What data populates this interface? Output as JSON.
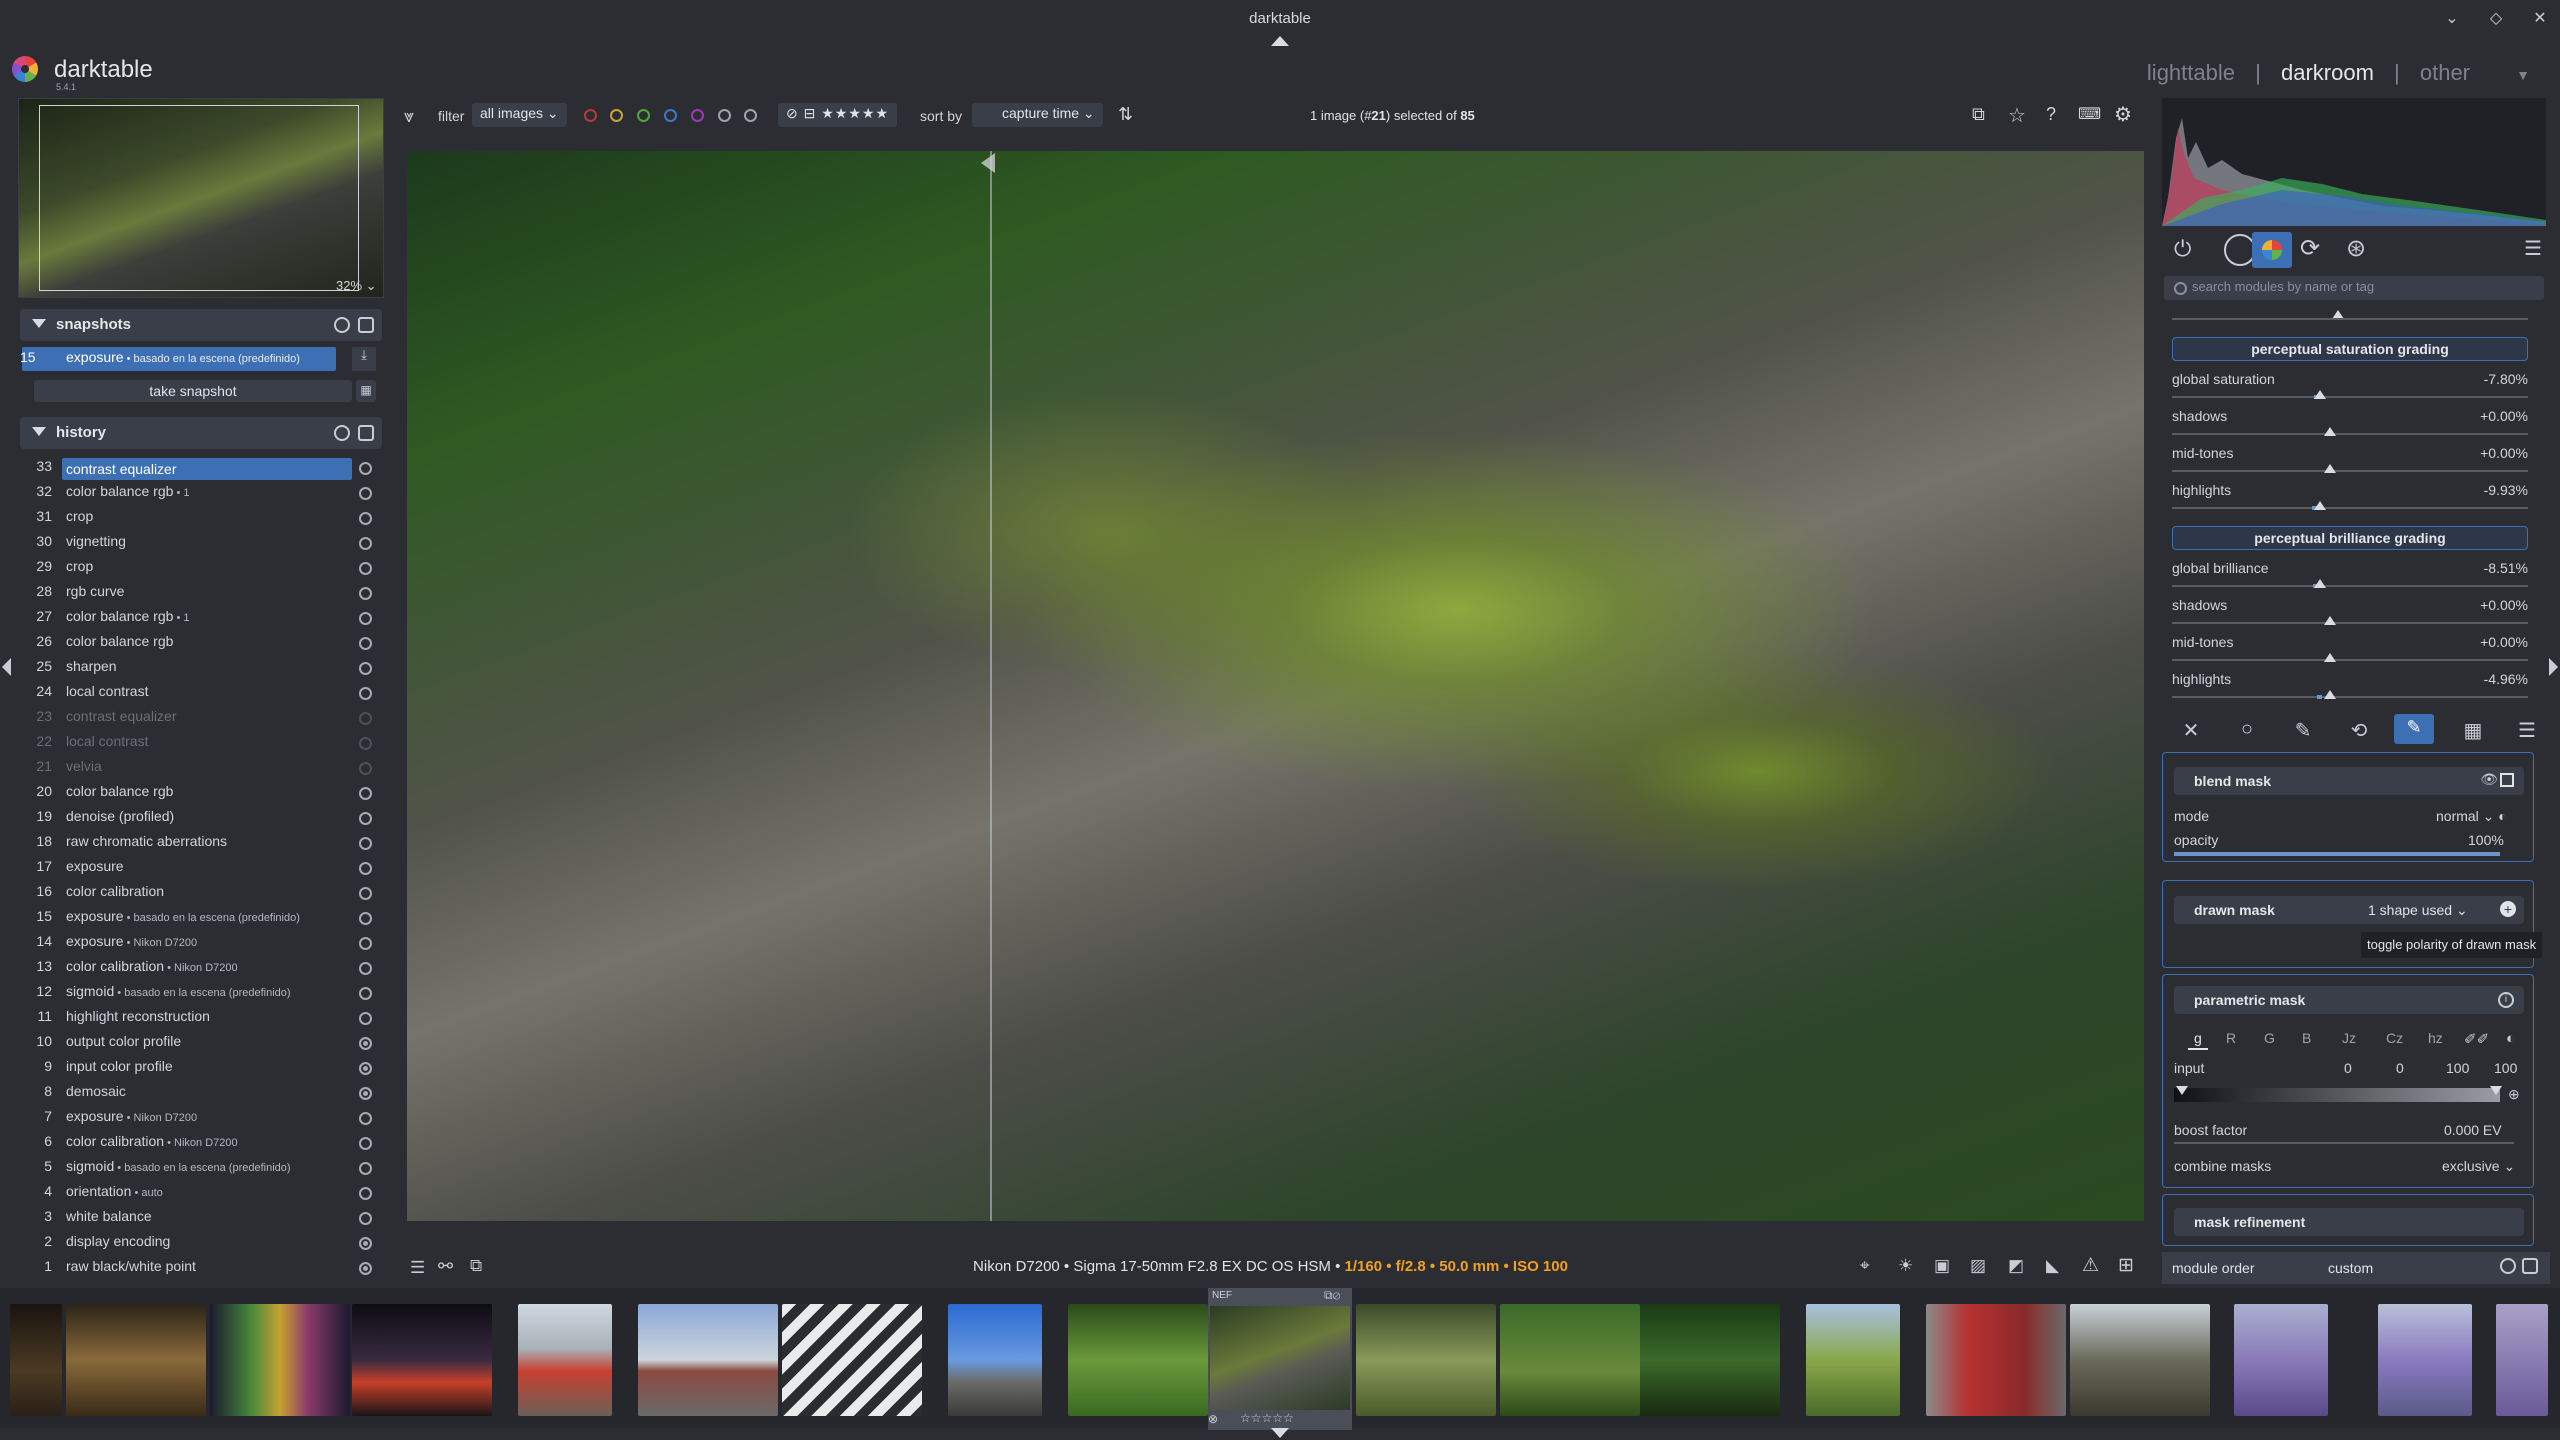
{
  "window": {
    "title": "darktable"
  },
  "app": {
    "name": "darktable",
    "version": "5.4.1"
  },
  "views": {
    "lighttable": "lighttable",
    "darkroom": "darkroom",
    "other": "other",
    "sep": "|"
  },
  "navigation": {
    "zoom": "32%"
  },
  "snapshots": {
    "title": "snapshots",
    "item": {
      "num": "15",
      "label": "exposure",
      "note": " • basado en la escena (predefinido)"
    },
    "take_label": "take snapshot"
  },
  "history": {
    "title": "history",
    "items": [
      {
        "num": "33",
        "label": "contrast equalizer",
        "note": ""
      },
      {
        "num": "32",
        "label": "color balance rgb",
        "note": " • 1"
      },
      {
        "num": "31",
        "label": "crop",
        "note": ""
      },
      {
        "num": "30",
        "label": "vignetting",
        "note": ""
      },
      {
        "num": "29",
        "label": "crop",
        "note": ""
      },
      {
        "num": "28",
        "label": "rgb curve",
        "note": ""
      },
      {
        "num": "27",
        "label": "color balance rgb",
        "note": " • 1"
      },
      {
        "num": "26",
        "label": "color balance rgb",
        "note": ""
      },
      {
        "num": "25",
        "label": "sharpen",
        "note": ""
      },
      {
        "num": "24",
        "label": "local contrast",
        "note": ""
      },
      {
        "num": "23",
        "label": "contrast equalizer",
        "note": ""
      },
      {
        "num": "22",
        "label": "local contrast",
        "note": ""
      },
      {
        "num": "21",
        "label": "velvia",
        "note": ""
      },
      {
        "num": "20",
        "label": "color balance rgb",
        "note": ""
      },
      {
        "num": "19",
        "label": "denoise (profiled)",
        "note": ""
      },
      {
        "num": "18",
        "label": "raw chromatic aberrations",
        "note": ""
      },
      {
        "num": "17",
        "label": "exposure",
        "note": ""
      },
      {
        "num": "16",
        "label": "color calibration",
        "note": ""
      },
      {
        "num": "15",
        "label": "exposure",
        "note": " • basado en la escena (predefinido)"
      },
      {
        "num": "14",
        "label": "exposure",
        "note": " • Nikon D7200"
      },
      {
        "num": "13",
        "label": "color calibration",
        "note": " • Nikon D7200"
      },
      {
        "num": "12",
        "label": "sigmoid",
        "note": " • basado en la escena (predefinido)"
      },
      {
        "num": "11",
        "label": "highlight reconstruction",
        "note": ""
      },
      {
        "num": "10",
        "label": "output color profile",
        "note": ""
      },
      {
        "num": "9",
        "label": "input color profile",
        "note": ""
      },
      {
        "num": "8",
        "label": "demosaic",
        "note": ""
      },
      {
        "num": "7",
        "label": "exposure",
        "note": " • Nikon D7200"
      },
      {
        "num": "6",
        "label": "color calibration",
        "note": " • Nikon D7200"
      },
      {
        "num": "5",
        "label": "sigmoid",
        "note": " • basado en la escena (predefinido)"
      },
      {
        "num": "4",
        "label": "orientation",
        "note": " • auto"
      },
      {
        "num": "3",
        "label": "white balance",
        "note": ""
      },
      {
        "num": "2",
        "label": "display encoding",
        "note": ""
      },
      {
        "num": "1",
        "label": "raw black/white point",
        "note": ""
      }
    ]
  },
  "toolbar": {
    "filter_label": "filter",
    "filter_value": "all images",
    "sort_label": "sort by",
    "sort_value": "capture time",
    "selection_pre": "1 image (#",
    "selection_num": "21",
    "selection_mid": ") selected of ",
    "selection_total": "85"
  },
  "exif": {
    "camera": "Nikon D7200 • Sigma 17-50mm F2.8 EX DC OS HSM • ",
    "shutter": "1/160",
    "aperture": "f/2.8",
    "focal": "50.0 mm",
    "iso": "ISO 100",
    "sep": " • "
  },
  "filmstrip": {
    "sel_badge": "NEF"
  },
  "right": {
    "search_placeholder": "search modules by name or tag",
    "saturation": {
      "title": "perceptual saturation grading",
      "rows": [
        {
          "label": "global saturation",
          "value": "-7.80%"
        },
        {
          "label": "shadows",
          "value": "+0.00%"
        },
        {
          "label": "mid-tones",
          "value": "+0.00%"
        },
        {
          "label": "highlights",
          "value": "-9.93%"
        }
      ]
    },
    "brilliance": {
      "title": "perceptual brilliance grading",
      "rows": [
        {
          "label": "global brilliance",
          "value": "-8.51%"
        },
        {
          "label": "shadows",
          "value": "+0.00%"
        },
        {
          "label": "mid-tones",
          "value": "+0.00%"
        },
        {
          "label": "highlights",
          "value": "-4.96%"
        }
      ]
    },
    "blend": {
      "title": "blend mask",
      "mode_label": "mode",
      "mode_value": "normal",
      "opacity_label": "opacity",
      "opacity_value": "100%"
    },
    "drawn": {
      "title": "drawn mask",
      "shapes": "1 shape used"
    },
    "tooltip": "toggle polarity of drawn mask",
    "parametric": {
      "title": "parametric mask",
      "channels": [
        "g",
        "R",
        "G",
        "B",
        "Jz",
        "Cz",
        "hz"
      ],
      "input_label": "input",
      "input_values": [
        "0",
        "0",
        "100",
        "100"
      ],
      "boost_label": "boost factor",
      "boost_value": "0.000 EV",
      "combine_label": "combine masks",
      "combine_value": "exclusive"
    },
    "refinement": {
      "title": "mask refinement"
    },
    "module_order": {
      "label": "module order",
      "value": "custom"
    }
  },
  "colors": {
    "accent": "#3d6fb5",
    "exif_highlight": "#f0a020",
    "panel_bg": "#2b2d33"
  }
}
